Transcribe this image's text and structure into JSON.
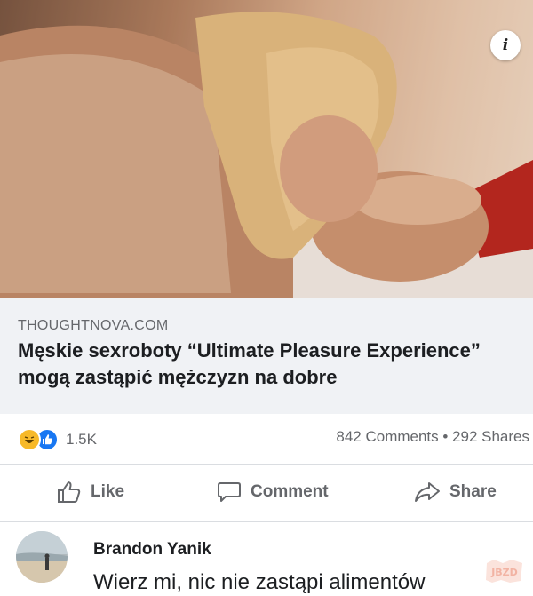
{
  "hero": {
    "info_icon": "info-icon",
    "info_glyph": "i"
  },
  "link_card": {
    "domain": "THOUGHTNOVA.COM",
    "headline": "Męskie sexroboty “Ultimate Pleasure Experience” mogą zastąpić mężczyzn na dobre"
  },
  "stats": {
    "reactions": [
      "haha-reaction-icon",
      "like-reaction-icon"
    ],
    "reaction_count": "1.5K",
    "comments_shares": "842 Comments • 292 Shares"
  },
  "actions": {
    "like_label": "Like",
    "comment_label": "Comment",
    "share_label": "Share"
  },
  "comment": {
    "author": "Brandon Yanik",
    "text": "Wierz mi, nic nie zastąpi alimentów"
  },
  "watermark": "JBZD"
}
